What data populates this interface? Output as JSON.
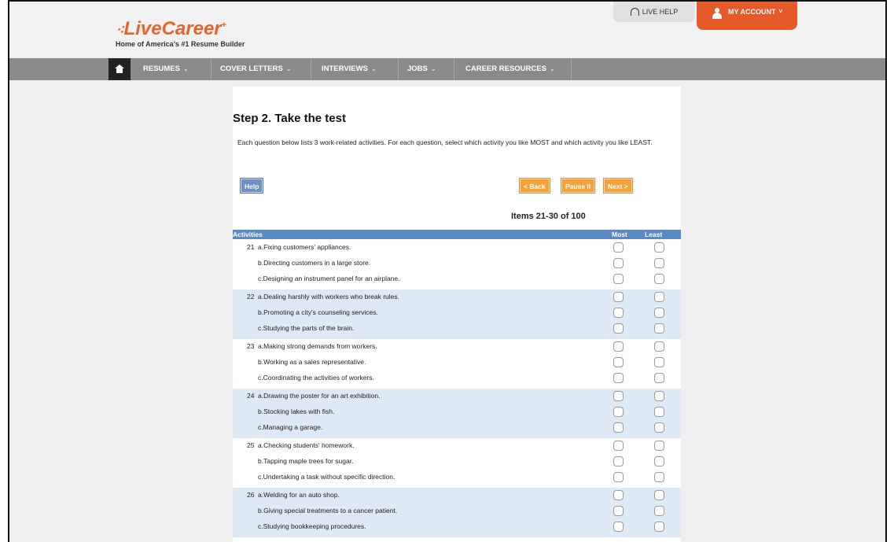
{
  "header": {
    "logo_text": "LiveCareer",
    "tagline": "Home of America's #1 Resume Builder",
    "live_help": "LIVE HELP",
    "my_account": "MY ACCOUNT"
  },
  "nav": {
    "items": [
      {
        "label": "RESUMES"
      },
      {
        "label": "COVER LETTERS"
      },
      {
        "label": "INTERVIEWS"
      },
      {
        "label": "JOBS"
      },
      {
        "label": "CAREER RESOURCES"
      }
    ]
  },
  "test": {
    "title": "Step 2. Take the test",
    "instructions": "Each question below lists 3 work-related activities. For each question, select which activity you like MOST and which activity you like LEAST.",
    "buttons": {
      "help": "Help",
      "back": "< Back",
      "pause": "Pause II",
      "next": "Next >"
    },
    "items_count": "Items 21-30 of 100",
    "columns": {
      "activities": "Activities",
      "most": "Most",
      "least": "Least"
    },
    "questions": [
      {
        "number": "21",
        "options": [
          "a.Fixing customers' appliances.",
          "b.Directing customers in a large store.",
          "c.Designing an instrument panel for an airplane."
        ]
      },
      {
        "number": "22",
        "options": [
          "a.Dealing harshly with workers who break rules.",
          "b.Promoting a city's counseling services.",
          "c.Studying the parts of the brain."
        ]
      },
      {
        "number": "23",
        "options": [
          "a.Making strong demands from workers.",
          "b.Working as a sales representative.",
          "c.Coordinating the activities of workers."
        ]
      },
      {
        "number": "24",
        "options": [
          "a.Drawing the poster for an art exhibition.",
          "b.Stocking lakes with fish.",
          "c.Managing a garage."
        ]
      },
      {
        "number": "25",
        "options": [
          "a.Checking students' homework.",
          "b.Tapping maple trees for sugar.",
          "c.Undertaking a task without specific direction."
        ]
      },
      {
        "number": "26",
        "options": [
          "a.Welding for an auto shop.",
          "b.Giving special treatments to a cancer patient.",
          "c.Studying bookkeeping procedures."
        ]
      }
    ]
  },
  "colors": {
    "brand_orange": "#e65a2a",
    "nav_gray": "#8a8a8a",
    "table_header_blue": "#5b89c2",
    "row_alt_blue": "#dde9f4",
    "button_orange": "#f5a23a",
    "button_blue": "#6d8fc4"
  },
  "icons": [
    "home-icon",
    "headphones-icon",
    "user-icon",
    "chevron-down-icon"
  ]
}
